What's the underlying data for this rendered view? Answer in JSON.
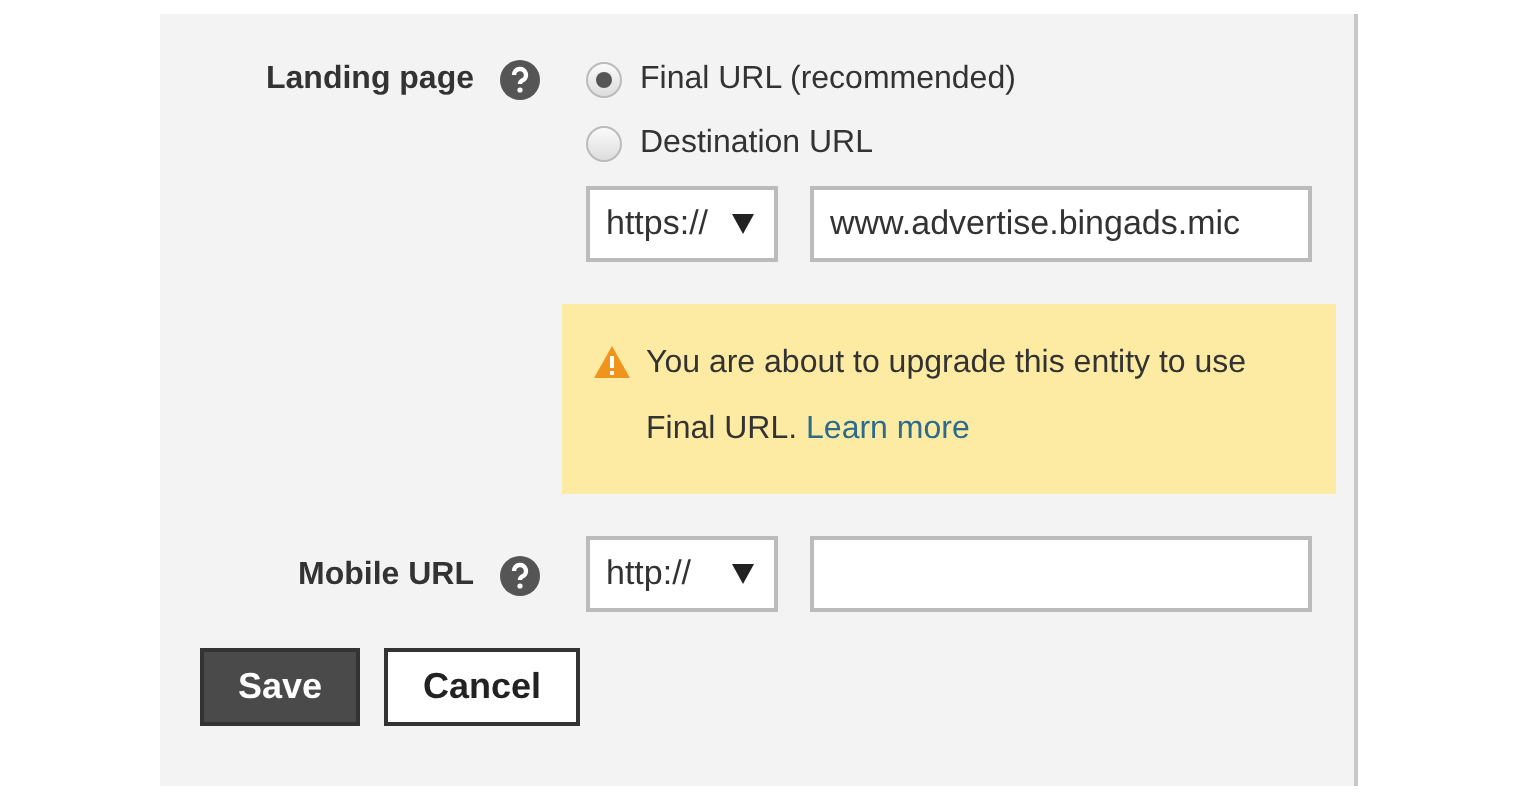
{
  "landing_page": {
    "label": "Landing page",
    "options": [
      {
        "label": "Final URL (recommended)",
        "selected": true
      },
      {
        "label": "Destination URL",
        "selected": false
      }
    ],
    "protocol": "https://",
    "url": "www.advertise.bingads.mic"
  },
  "warning": {
    "text": "You are about to upgrade this entity to use Final URL.",
    "link": "Learn more"
  },
  "mobile_url": {
    "label": "Mobile URL",
    "protocol": "http://"
  },
  "buttons": [
    {
      "label": "Save",
      "kind": "primary"
    },
    {
      "label": "Cancel",
      "kind": "secondary"
    }
  ]
}
